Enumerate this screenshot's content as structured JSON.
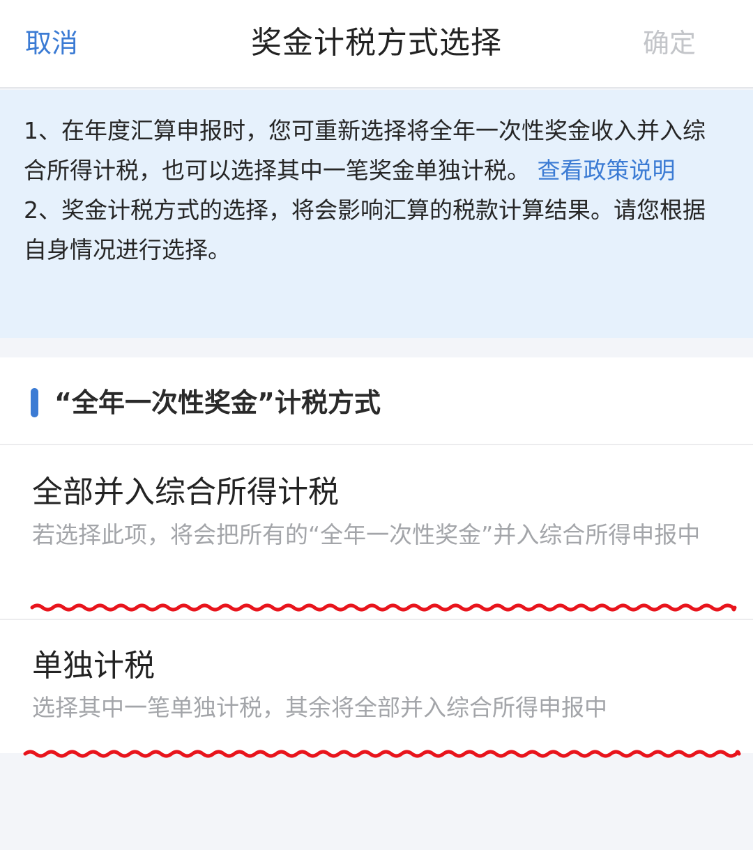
{
  "header": {
    "cancel_label": "取消",
    "title": "奖金计税方式选择",
    "confirm_label": "确定"
  },
  "notice": {
    "line1_text": "1、在年度汇算申报时，您可重新选择将全年一次性奖金收入并入综合所得计税，也可以选择其中一笔奖金单独计税。",
    "line1_link": "查看政策说明",
    "line2_text": "2、奖金计税方式的选择，将会影响汇算的税款计算结果。请您根据自身情况进行选择。"
  },
  "section": {
    "title": "“全年一次性奖金”计税方式",
    "options": [
      {
        "title": "全部并入综合所得计税",
        "description": "若选择此项，将会把所有的“全年一次性奖金”并入综合所得申报中"
      },
      {
        "title": "单独计税",
        "description": "选择其中一笔单独计税，其余将全部并入综合所得申报中"
      }
    ]
  },
  "colors": {
    "accent": "#3b7bd4",
    "notice_bg": "#e6f1fc",
    "muted_text": "#a3a5a9",
    "annotation_red": "#e8141c"
  }
}
